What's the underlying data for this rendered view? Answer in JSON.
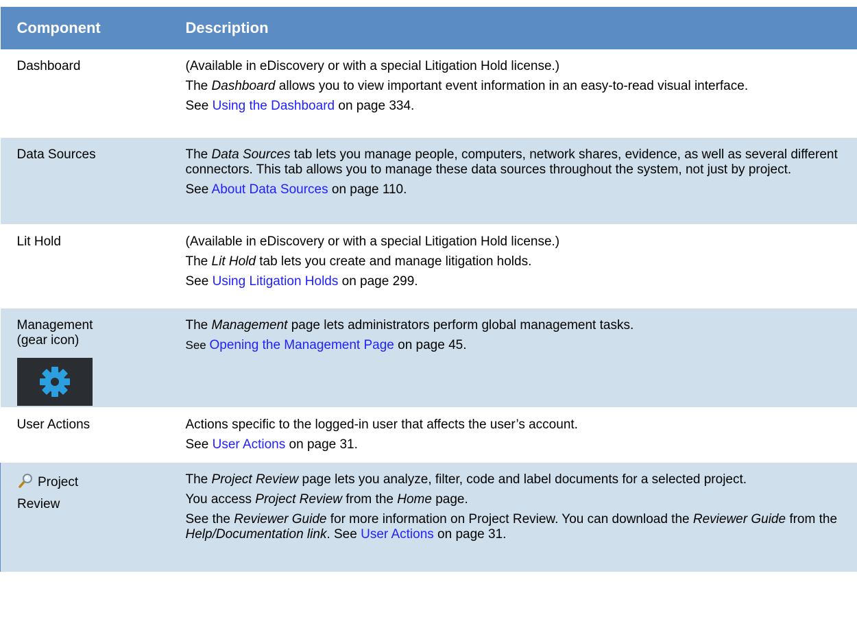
{
  "header": {
    "component": "Component",
    "description": "Description"
  },
  "rows": {
    "dashboard": {
      "name": "Dashboard",
      "p1": "(Available in eDiscovery or with a special Litigation Hold license.)",
      "p2_pre": "The ",
      "p2_em": "Dashboard",
      "p2_post": " allows you to view important event information in an easy-to-read visual interface.",
      "see_pre": "See ",
      "see_link": "Using the Dashboard",
      "see_post": " on page 334."
    },
    "data_sources": {
      "name": "Data Sources",
      "p1_pre": "The ",
      "p1_em": "Data Sources",
      "p1_post": " tab lets you manage people, computers, network shares, evidence, as well as several different connectors. This tab allows you to manage these data sources throughout the system, not just by project.",
      "see_pre": "See ",
      "see_link": "About Data Sources",
      "see_post": " on page 110."
    },
    "lit_hold": {
      "name": "Lit Hold",
      "p1": "(Available in eDiscovery or with a special Litigation Hold license.)",
      "p2_pre": "The ",
      "p2_em": "Lit Hold",
      "p2_post": " tab lets you create and manage litigation holds.",
      "see_pre": "See ",
      "see_link": "Using Litigation Holds",
      "see_post": " on page 299."
    },
    "management": {
      "name_line1": "Management",
      "name_line2": "(gear icon)",
      "p1_pre": "The ",
      "p1_em": "Management",
      "p1_post": " page lets administrators perform global management tasks.",
      "see_pre": "See ",
      "see_link": "Opening the Management Page",
      "see_post": " on page 45."
    },
    "user_actions": {
      "name": "User Actions",
      "p1": "Actions specific to the logged-in user that affects the user’s account.",
      "see_pre": "See ",
      "see_link": "User Actions",
      "see_post": " on page 31."
    },
    "project_review": {
      "name_line1": "Project",
      "name_line2": "Review",
      "p1_pre": "The ",
      "p1_em": "Project Review",
      "p1_post": " page lets you analyze, filter, code and label documents for a selected project.",
      "p2_pre": "You access ",
      "p2_em": "Project Review",
      "p2_mid": " from the ",
      "p2_em2": "Home",
      "p2_post": " page.",
      "p3_pre": "See the ",
      "p3_em": "Reviewer Guide",
      "p3_mid": " for more information on Project Review. You can download the ",
      "p3_em2": "Reviewer Guide",
      "p3_mid2": " from the ",
      "p3_em3": "Help/Documentation link",
      "p3_mid3": ". See ",
      "p3_link": "User Actions",
      "p3_post": " on page 31."
    }
  },
  "colors": {
    "header_bg": "#5b8cc4",
    "stripe_bg": "#cfe0ec",
    "link": "#1f1fff",
    "gear": "#2b9fe0"
  }
}
